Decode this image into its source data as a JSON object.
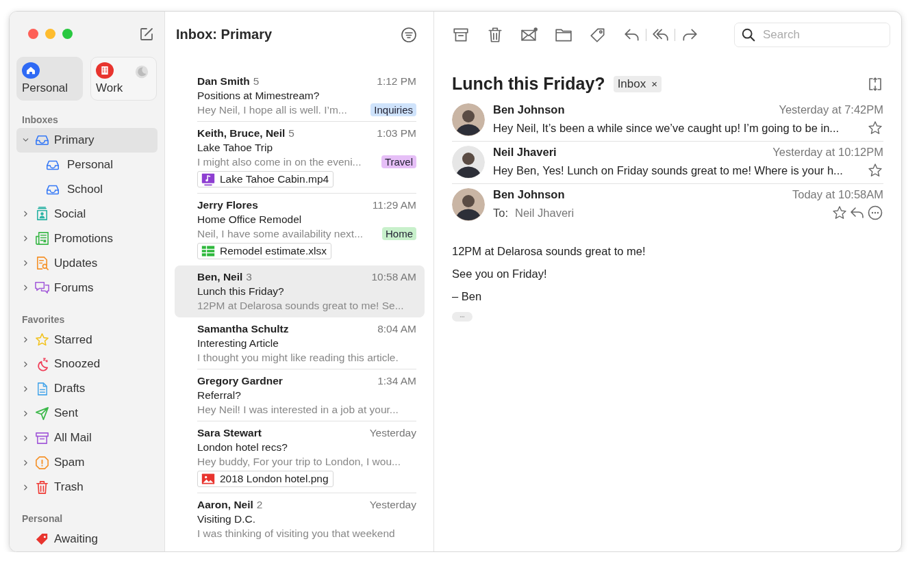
{
  "accounts": [
    {
      "name": "Personal",
      "selected": true,
      "do_not_disturb": false
    },
    {
      "name": "Work",
      "selected": false,
      "do_not_disturb": true
    }
  ],
  "sidebar": {
    "sections": [
      {
        "title": "Inboxes",
        "items": [
          {
            "label": "Primary",
            "selected": true,
            "expanded": true,
            "children": [
              {
                "label": "Personal",
                "selected": false
              },
              {
                "label": "School",
                "selected": false
              }
            ]
          },
          {
            "label": "Social",
            "selected": false,
            "expanded": false
          },
          {
            "label": "Promotions",
            "selected": false,
            "expanded": false
          },
          {
            "label": "Updates",
            "selected": false,
            "expanded": false
          },
          {
            "label": "Forums",
            "selected": false,
            "expanded": false
          }
        ]
      },
      {
        "title": "Favorites",
        "items": [
          {
            "label": "Starred",
            "selected": false,
            "expanded": false
          },
          {
            "label": "Snoozed",
            "selected": false,
            "expanded": false
          },
          {
            "label": "Drafts",
            "selected": false,
            "expanded": false
          },
          {
            "label": "Sent",
            "selected": false,
            "expanded": false
          },
          {
            "label": "All Mail",
            "selected": false,
            "expanded": false
          },
          {
            "label": "Spam",
            "selected": false,
            "expanded": false
          },
          {
            "label": "Trash",
            "selected": false,
            "expanded": false
          }
        ]
      },
      {
        "title": "Personal",
        "items": [
          {
            "label": "Awaiting",
            "selected": false
          }
        ]
      }
    ]
  },
  "message_list": {
    "title": "Inbox: Primary",
    "messages": [
      {
        "sender": "Dan Smith",
        "count": "5",
        "time": "1:12 PM",
        "subject": "Positions at Mimestream?",
        "preview": "Hey Neil, I hope all is well. I’m...",
        "tag": {
          "label": "Inquiries",
          "color": "#cfe3fb"
        },
        "selected": false
      },
      {
        "sender": "Keith, Bruce, Neil",
        "count": "5",
        "time": "1:03 PM",
        "subject": "Lake Tahoe Trip",
        "preview": "I might also come in on the eveni...",
        "tag": {
          "label": "Travel",
          "color": "#e6bff7"
        },
        "attachment": {
          "name": "Lake Tahoe Cabin.mp4",
          "kind": "video"
        },
        "selected": false
      },
      {
        "sender": "Jerry Flores",
        "time": "11:29 AM",
        "subject": "Home Office Remodel",
        "preview": "Neil, I have some availability next...",
        "tag": {
          "label": "Home",
          "color": "#c8f0cb"
        },
        "attachment": {
          "name": "Remodel estimate.xlsx",
          "kind": "spreadsheet"
        },
        "selected": false
      },
      {
        "sender": "Ben, Neil",
        "count": "3",
        "time": "10:58 AM",
        "subject": "Lunch this Friday?",
        "preview": "12PM at Delarosa sounds great to me! Se...",
        "selected": true
      },
      {
        "sender": "Samantha Schultz",
        "time": "8:04 AM",
        "subject": "Interesting Article",
        "preview": "I thought you might like reading this article.",
        "selected": false
      },
      {
        "sender": "Gregory Gardner",
        "time": "1:34 AM",
        "subject": "Referral?",
        "preview": "Hey Neil! I was interested in a job at your...",
        "selected": false
      },
      {
        "sender": "Sara Stewart",
        "time": "Yesterday",
        "subject": "London hotel recs?",
        "preview": "Hey buddy, For your trip to London, I wou...",
        "attachment": {
          "name": "2018 London hotel.png",
          "kind": "image"
        },
        "selected": false
      },
      {
        "sender": "Aaron, Neil",
        "count": "2",
        "time": "Yesterday",
        "subject": "Visiting D.C.",
        "preview": "I was thinking of visiting you that weekend",
        "selected": false
      }
    ]
  },
  "reader": {
    "search": {
      "placeholder": "Search"
    },
    "subject": "Lunch this Friday?",
    "labels": [
      {
        "label": "Inbox",
        "remove": "×"
      }
    ],
    "thread": [
      {
        "sender": "Ben Johnson",
        "time": "Yesterday at 7:42PM",
        "preview": "Hey Neil, It’s been a while since we’ve caught up! I’m going to be in...",
        "starred": false,
        "expanded": false
      },
      {
        "sender": "Neil Jhaveri",
        "time": "Yesterday at 10:12PM",
        "preview": "Hey Ben, Yes! Lunch on Friday sounds great to me! Where is your h...",
        "starred": false,
        "expanded": false
      },
      {
        "sender": "Ben Johnson",
        "time": "Today at 10:58AM",
        "to_label": "To:",
        "to": "Neil Jhaveri",
        "starred": false,
        "expanded": true,
        "body": [
          "12PM at Delarosa sounds great to me!",
          "See you on Friday!",
          "– Ben"
        ]
      }
    ]
  }
}
